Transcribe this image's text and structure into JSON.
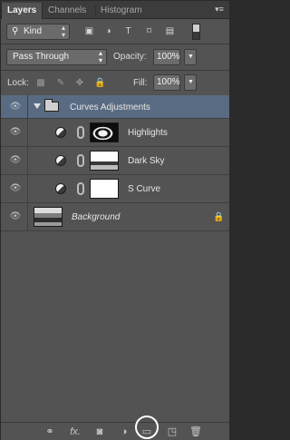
{
  "tabs": [
    {
      "label": "Layers",
      "active": true
    },
    {
      "label": "Channels",
      "active": false
    },
    {
      "label": "Histogram",
      "active": false
    }
  ],
  "filter": {
    "kind_label": "Kind",
    "icons": [
      "image-filter-icon",
      "adjustment-filter-icon",
      "type-filter-icon",
      "shape-filter-icon",
      "smart-object-filter-icon"
    ]
  },
  "blend": {
    "mode": "Pass Through",
    "opacity_label": "Opacity:",
    "opacity_value": "100%"
  },
  "lock": {
    "label": "Lock:",
    "fill_label": "Fill:",
    "fill_value": "100%"
  },
  "layers": [
    {
      "name": "Curves Adjustments",
      "type": "group",
      "visible": true
    },
    {
      "name": "Highlights",
      "type": "adjustment",
      "visible": true
    },
    {
      "name": "Dark Sky",
      "type": "adjustment",
      "visible": true
    },
    {
      "name": "S Curve",
      "type": "adjustment",
      "visible": true
    },
    {
      "name": "Background",
      "type": "background",
      "visible": true,
      "locked": true
    }
  ],
  "bottom_icons": [
    "link-layers-icon",
    "fx-icon",
    "add-mask-icon",
    "new-adjustment-icon",
    "new-group-icon",
    "new-layer-icon",
    "delete-layer-icon"
  ],
  "colors": {
    "panel_bg": "#535353",
    "selected_group": "#596b82",
    "highlight_ring": "#ffffff"
  }
}
